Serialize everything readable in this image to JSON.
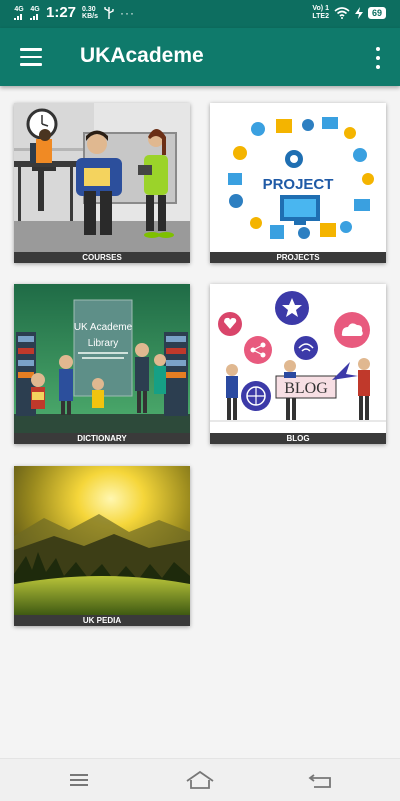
{
  "status_bar": {
    "network_1": "4G",
    "network_2": "4G",
    "time": "1:27",
    "speed_value": "0.30",
    "speed_unit": "KB/s",
    "volte_1": "Vo) 1",
    "volte_2": "LTE2",
    "battery": "69",
    "icons": [
      "usb-icon",
      "more-notifications-icon",
      "signal-icon",
      "wifi-icon",
      "charging-icon",
      "battery-icon"
    ]
  },
  "app_bar": {
    "title": "UKAcademe",
    "icons": [
      "hamburger-menu-icon",
      "overflow-menu-icon"
    ]
  },
  "tiles": [
    {
      "label": "COURSES"
    },
    {
      "label": "PROJECTS"
    },
    {
      "label": "DICTIONARY"
    },
    {
      "label": "BLOG"
    },
    {
      "label": "UK PEDIA"
    }
  ],
  "tile_art": {
    "project_word": "PROJECT",
    "library_line_1": "UK Academe",
    "library_line_2": "Library",
    "blog_word": "BLOG"
  },
  "nav_bar": {
    "icons": [
      "recents-icon",
      "home-icon",
      "back-icon"
    ]
  },
  "colors": {
    "status_bar": "#0d6e60",
    "app_bar": "#0f7a6b",
    "background": "#f4f4f4",
    "tile_label_bg": "#3a3a3a"
  }
}
